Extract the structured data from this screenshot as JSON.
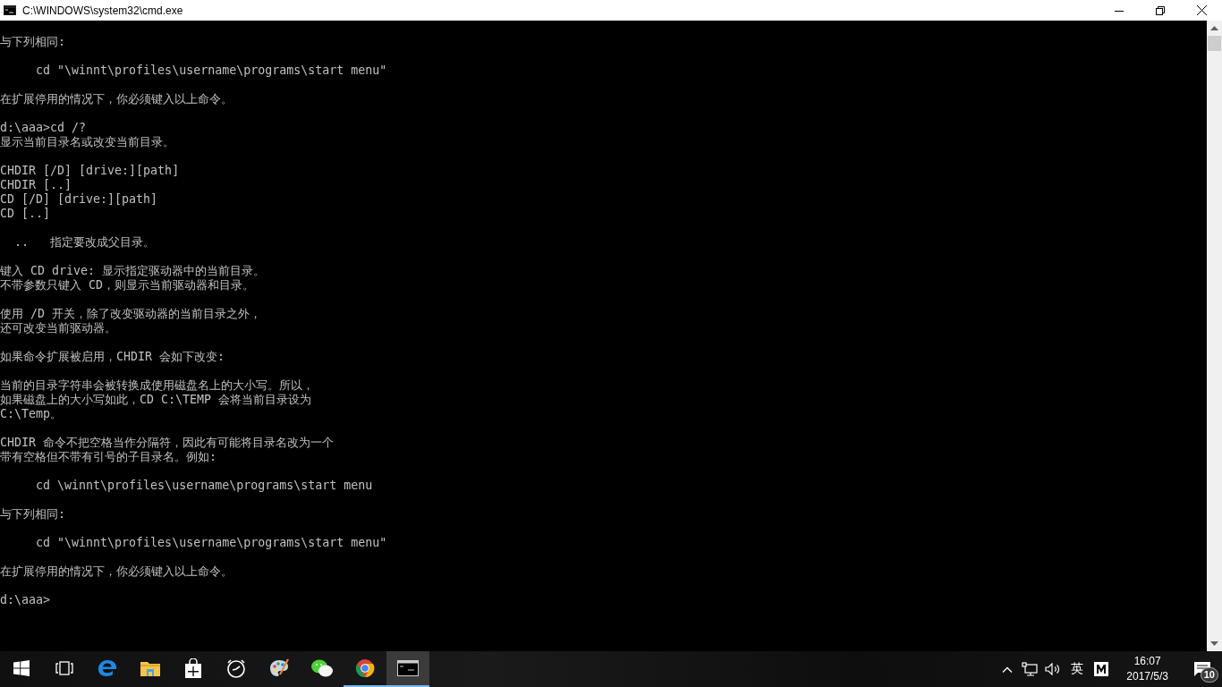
{
  "window": {
    "title": "C:\\WINDOWS\\system32\\cmd.exe"
  },
  "console": {
    "paragraphs": [
      {
        "lines": [
          "与下列相同:"
        ]
      },
      {
        "lines": [
          "     cd \"\\winnt\\profiles\\username\\programs\\start menu\""
        ]
      },
      {
        "lines": [
          "在扩展停用的情况下，你必须键入以上命令。"
        ]
      },
      {
        "lines": [
          "d:\\aaa>cd /?",
          "显示当前目录名或改变当前目录。"
        ]
      },
      {
        "lines": [
          "CHDIR [/D] [drive:][path]",
          "CHDIR [..]",
          "CD [/D] [drive:][path]",
          "CD [..]"
        ]
      },
      {
        "lines": [
          "  ..   指定要改成父目录。"
        ]
      },
      {
        "lines": [
          "键入 CD drive: 显示指定驱动器中的当前目录。",
          "不带参数只键入 CD，则显示当前驱动器和目录。"
        ]
      },
      {
        "lines": [
          "使用 /D 开关，除了改变驱动器的当前目录之外，",
          "还可改变当前驱动器。"
        ]
      },
      {
        "lines": [
          "如果命令扩展被启用，CHDIR 会如下改变:"
        ]
      },
      {
        "lines": [
          "当前的目录字符串会被转换成使用磁盘名上的大小写。所以，",
          "如果磁盘上的大小写如此，CD C:\\TEMP 会将当前目录设为",
          "C:\\Temp。"
        ]
      },
      {
        "lines": [
          "CHDIR 命令不把空格当作分隔符，因此有可能将目录名改为一个",
          "带有空格但不带有引号的子目录名。例如:"
        ]
      },
      {
        "lines": [
          "     cd \\winnt\\profiles\\username\\programs\\start menu"
        ]
      },
      {
        "lines": [
          "与下列相同:"
        ]
      },
      {
        "lines": [
          "     cd \"\\winnt\\profiles\\username\\programs\\start menu\""
        ]
      },
      {
        "lines": [
          "在扩展停用的情况下，你必须键入以上命令。"
        ]
      },
      {
        "lines": [
          "d:\\aaa>"
        ]
      }
    ]
  },
  "taskbar": {
    "buttons": [
      {
        "running": false,
        "selected": false
      },
      {
        "running": false,
        "selected": false
      },
      {
        "running": false,
        "selected": false
      },
      {
        "running": false,
        "selected": false
      },
      {
        "running": false,
        "selected": false
      },
      {
        "running": false,
        "selected": false
      },
      {
        "running": false,
        "selected": false
      },
      {
        "running": false,
        "selected": false
      },
      {
        "running": true,
        "selected": false
      },
      {
        "running": true,
        "selected": true
      }
    ]
  },
  "tray": {
    "input_language": "英",
    "time": "16:07",
    "date": "2017/5/3",
    "notification_count": "10"
  }
}
